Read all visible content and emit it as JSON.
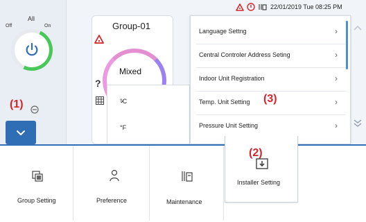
{
  "status": {
    "date_time": "22/01/2019 Tue 08:25 PM",
    "icons": [
      "warning-icon",
      "settings-status-icon",
      "maintenance-status-icon"
    ]
  },
  "power": {
    "all_label": "All",
    "off_label": "Off",
    "on_label": "On"
  },
  "group": {
    "title": "Group-01",
    "mode": "Mixed"
  },
  "temp_units": {
    "options": [
      {
        "label": "°C",
        "selected": true
      },
      {
        "label": "°F",
        "selected": false
      }
    ]
  },
  "menu": {
    "items": [
      {
        "label": "Language Settng"
      },
      {
        "label": "Central Controler Address Seting"
      },
      {
        "label": "Indoor Unit Registration"
      },
      {
        "label": "Temp. Unit Setting"
      },
      {
        "label": "Pressure Unit Setting"
      }
    ]
  },
  "bottom_nav": {
    "items": [
      {
        "label": "Group Setting",
        "icon": "group-setting-icon"
      },
      {
        "label": "Preference",
        "icon": "preference-icon"
      },
      {
        "label": "Maintenance",
        "icon": "maintenance-icon"
      },
      {
        "label": "Installer Setting",
        "icon": "installer-setting-icon"
      }
    ]
  },
  "annotations": {
    "m1": "(1)",
    "m2": "(2)",
    "m3": "(3)"
  },
  "colors": {
    "accent": "#2f6db5",
    "warning": "#d6242a",
    "power_on": "#49c85a"
  }
}
